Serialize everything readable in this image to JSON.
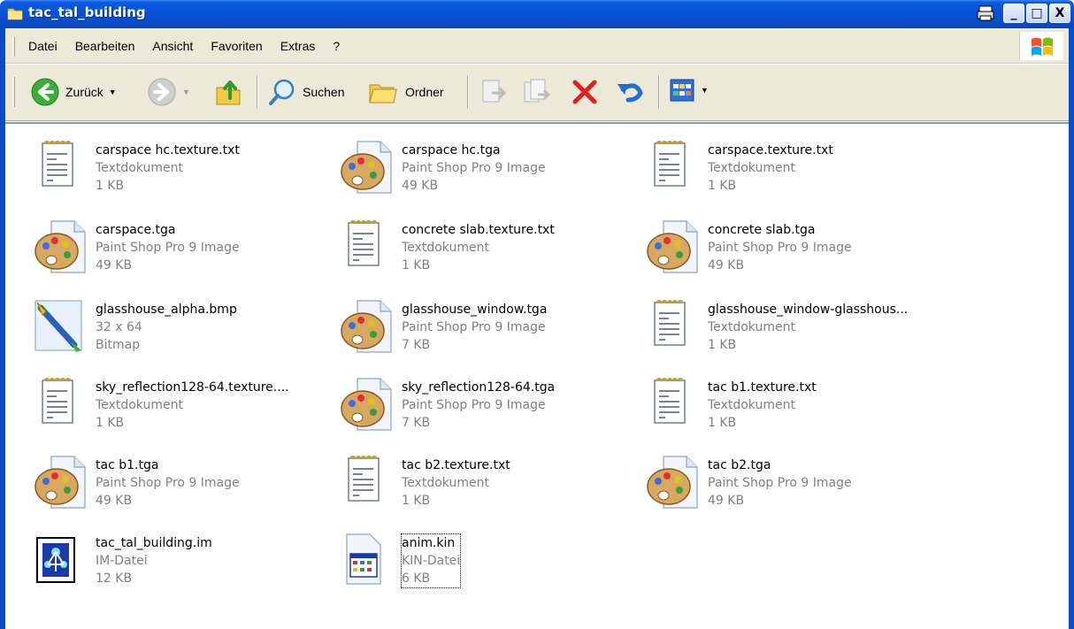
{
  "window": {
    "title": "tac_tal_building",
    "buttons": {
      "print": "🖶",
      "minimize": "_",
      "maximize": "□",
      "close": "X"
    }
  },
  "menu": {
    "items": [
      "Datei",
      "Bearbeiten",
      "Ansicht",
      "Favoriten",
      "Extras",
      "?"
    ]
  },
  "toolbar": {
    "back_label": "Zurück",
    "search_label": "Suchen",
    "folders_label": "Ordner"
  },
  "colors": {
    "title_blue": "#0a4cc6",
    "toolbar_bg": "#ece9d8",
    "meta_gray": "#808080",
    "delete_red": "#e02020"
  },
  "files": [
    {
      "name": "carspace hc.texture.txt",
      "type": "Textdokument",
      "size": "1 KB",
      "icon": "text-document-icon"
    },
    {
      "name": "carspace hc.tga",
      "type": "Paint Shop Pro 9 Image",
      "size": "49 KB",
      "icon": "paint-palette-icon"
    },
    {
      "name": "carspace.texture.txt",
      "type": "Textdokument",
      "size": "1 KB",
      "icon": "text-document-icon"
    },
    {
      "name": "carspace.tga",
      "type": "Paint Shop Pro 9 Image",
      "size": "49 KB",
      "icon": "paint-palette-icon"
    },
    {
      "name": "concrete slab.texture.txt",
      "type": "Textdokument",
      "size": "1 KB",
      "icon": "text-document-icon"
    },
    {
      "name": "concrete slab.tga",
      "type": "Paint Shop Pro 9 Image",
      "size": "49 KB",
      "icon": "paint-palette-icon"
    },
    {
      "name": "glasshouse_alpha.bmp",
      "type": "32 x 64",
      "size": "Bitmap",
      "icon": "paint-brush-icon"
    },
    {
      "name": "glasshouse_window.tga",
      "type": "Paint Shop Pro 9 Image",
      "size": "7 KB",
      "icon": "paint-palette-icon"
    },
    {
      "name": "glasshouse_window-glasshous...",
      "type": "Textdokument",
      "size": "1 KB",
      "icon": "text-document-icon"
    },
    {
      "name": "sky_reflection128-64.texture....",
      "type": "Textdokument",
      "size": "1 KB",
      "icon": "text-document-icon"
    },
    {
      "name": "sky_reflection128-64.tga",
      "type": "Paint Shop Pro 9 Image",
      "size": "7 KB",
      "icon": "paint-palette-icon"
    },
    {
      "name": "tac b1.texture.txt",
      "type": "Textdokument",
      "size": "1 KB",
      "icon": "text-document-icon"
    },
    {
      "name": "tac b1.tga",
      "type": "Paint Shop Pro 9 Image",
      "size": "49 KB",
      "icon": "paint-palette-icon"
    },
    {
      "name": "tac b2.texture.txt",
      "type": "Textdokument",
      "size": "1 KB",
      "icon": "text-document-icon"
    },
    {
      "name": "tac b2.tga",
      "type": "Paint Shop Pro 9 Image",
      "size": "49 KB",
      "icon": "paint-palette-icon"
    },
    {
      "name": "tac_tal_building.im",
      "type": "IM-Datei",
      "size": "12 KB",
      "icon": "im-file-icon"
    },
    {
      "name": "anim.kin",
      "type": "KIN-Datei",
      "size": "6 KB",
      "icon": "kin-file-icon",
      "selected": true
    }
  ]
}
